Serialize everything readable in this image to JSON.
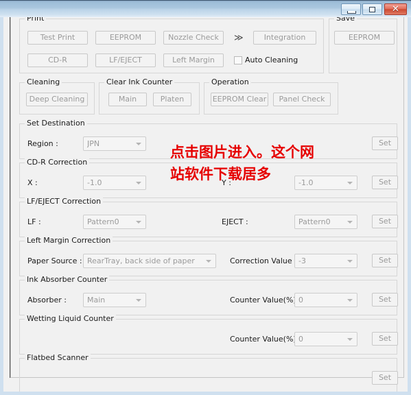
{
  "window": {
    "titlebar": {
      "minimize_label": "minimize",
      "maximize_label": "maximize",
      "close_glyph": "✕"
    }
  },
  "groups": {
    "print": {
      "title": "Print",
      "buttons": [
        {
          "label": "Test Print"
        },
        {
          "label": "EEPROM"
        },
        {
          "label": "Nozzle Check"
        },
        {
          "label": "CD-R"
        },
        {
          "label": "LF/EJECT"
        },
        {
          "label": "Left Margin"
        }
      ],
      "chevron": "≫",
      "integration_label": "Integration",
      "auto_cleaning_label": "Auto Cleaning"
    },
    "save": {
      "title": "Save",
      "eeprom_label": "EEPROM"
    },
    "cleaning": {
      "title": "Cleaning",
      "deep_cleaning_label": "Deep Cleaning"
    },
    "clear_ink_counter": {
      "title": "Clear Ink Counter",
      "main_label": "Main",
      "platen_label": "Platen"
    },
    "operation": {
      "title": "Operation",
      "eeprom_clear_label": "EEPROM Clear",
      "panel_check_label": "Panel Check"
    },
    "set_destination": {
      "title": "Set Destination",
      "region_label": "Region :",
      "region_value": "JPN",
      "set_label": "Set"
    },
    "cdr_correction": {
      "title": "CD-R Correction",
      "x_label": "X :",
      "x_value": "-1.0",
      "y_label": "Y :",
      "y_value": "-1.0",
      "set_label": "Set"
    },
    "lf_eject_correction": {
      "title": "LF/EJECT Correction",
      "lf_label": "LF :",
      "lf_value": "Pattern0",
      "eject_label": "EJECT :",
      "eject_value": "Pattern0",
      "set_label": "Set"
    },
    "left_margin_correction": {
      "title": "Left Margin Correction",
      "paper_source_label": "Paper Source :",
      "paper_source_value": "RearTray, back side of paper",
      "correction_value_label": "Correction Value :",
      "correction_value": "-3",
      "set_label": "Set"
    },
    "ink_absorber_counter": {
      "title": "Ink Absorber Counter",
      "absorber_label": "Absorber :",
      "absorber_value": "Main",
      "counter_value_label": "Counter Value(%) :",
      "counter_value": "0",
      "set_label": "Set"
    },
    "wetting_liquid_counter": {
      "title": "Wetting Liquid Counter",
      "counter_value_label": "Counter Value(%) :",
      "counter_value": "0",
      "set_label": "Set"
    },
    "flatbed_scanner": {
      "title": "Flatbed Scanner",
      "set_label": "Set"
    }
  },
  "overlay": {
    "text": "点击图片进入。这个网\n站软件下载居多",
    "color": "#e60000"
  }
}
